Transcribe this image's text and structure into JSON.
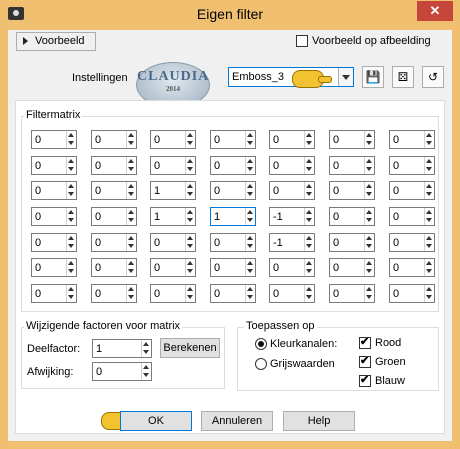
{
  "window": {
    "title": "Eigen filter",
    "close": "✕"
  },
  "top": {
    "preview_toggle": "Voorbeeld",
    "preview_on_image": "Voorbeeld op afbeelding",
    "settings_label": "Instellingen",
    "preset_value": "Emboss_3",
    "logo_text": "CLAUDIA",
    "logo_sub": "2014",
    "save_icon": "save-icon",
    "randomize_icon": "dice-icon",
    "reset_icon": "reset-icon"
  },
  "matrix": {
    "title": "Filtermatrix",
    "rows": [
      [
        "0",
        "0",
        "0",
        "0",
        "0",
        "0",
        "0"
      ],
      [
        "0",
        "0",
        "0",
        "0",
        "0",
        "0",
        "0"
      ],
      [
        "0",
        "0",
        "1",
        "0",
        "0",
        "0",
        "0"
      ],
      [
        "0",
        "0",
        "1",
        "1",
        "-1",
        "0",
        "0"
      ],
      [
        "0",
        "0",
        "0",
        "0",
        "-1",
        "0",
        "0"
      ],
      [
        "0",
        "0",
        "0",
        "0",
        "0",
        "0",
        "0"
      ],
      [
        "0",
        "0",
        "0",
        "0",
        "0",
        "0",
        "0"
      ]
    ]
  },
  "factors": {
    "title": "Wijzigende factoren voor matrix",
    "divisor_label": "Deelfactor:",
    "divisor_value": "1",
    "calc_button": "Berekenen",
    "offset_label": "Afwijking:",
    "offset_value": "0"
  },
  "apply": {
    "title": "Toepassen op",
    "color_channels": "Kleurkanalen:",
    "grayscale": "Grijswaarden",
    "red": "Rood",
    "green": "Groen",
    "blue": "Blauw"
  },
  "buttons": {
    "ok": "OK",
    "cancel": "Annuleren",
    "help": "Help"
  },
  "colors": {
    "title_bar": "#f0c070",
    "close": "#c7463b",
    "focus": "#0078d7"
  }
}
